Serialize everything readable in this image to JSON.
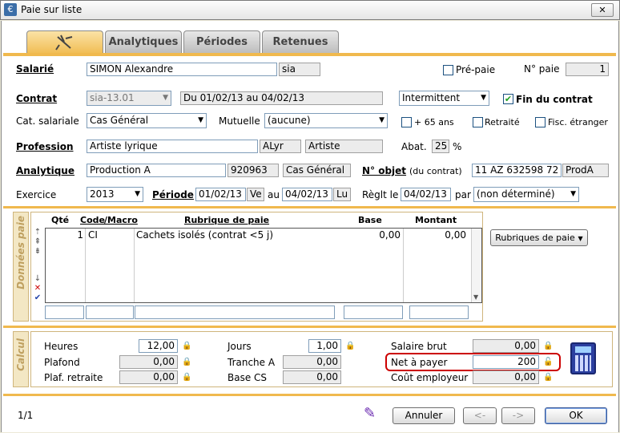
{
  "window": {
    "title": "Paie sur liste",
    "close": "✕"
  },
  "tabs": [
    {
      "label": ""
    },
    {
      "label": "Analytiques"
    },
    {
      "label": "Périodes"
    },
    {
      "label": "Retenues"
    }
  ],
  "header": {
    "salarie_label": "Salarié",
    "salarie_name": "SIMON Alexandre",
    "salarie_code": "sia",
    "prepaie_label": "Pré-paie",
    "no_paie_label": "N° paie",
    "no_paie": "1",
    "contrat_label": "Contrat",
    "contrat_code": "sia-13.01",
    "contrat_dates": "Du 01/02/13 au 04/02/13",
    "contrat_type": "Intermittent",
    "fin_contrat_label": "Fin du contrat",
    "cat_label": "Cat. salariale",
    "cat_value": "Cas Général",
    "mutuelle_label": "Mutuelle",
    "mutuelle_value": "(aucune)",
    "plus65_label": "+ 65 ans",
    "retraite_label": "Retraité",
    "fisc_label": "Fisc. étranger",
    "profession_label": "Profession",
    "profession_value": "Artiste lyrique",
    "profession_code": "ALyr",
    "profession_cat": "Artiste",
    "abat_label": "Abat.",
    "abat_value": "25",
    "abat_unit": "%",
    "analytique_label": "Analytique",
    "analytique_value": "Production A",
    "analytique_code": "920963",
    "analytique_cat": "Cas Général",
    "no_objet_label": "N° objet",
    "no_objet_sub": "(du contrat)",
    "no_objet_value": "11 AZ 632598 72",
    "no_objet_code": "ProdA",
    "exercice_label": "Exercice",
    "exercice_value": "2013",
    "periode_label": "Période",
    "periode_start": "01/02/13",
    "periode_start_day": "Ve",
    "au_label": "au",
    "periode_end": "04/02/13",
    "periode_end_day": "Lu",
    "reglt_label": "Règlt le",
    "reglt_date": "04/02/13",
    "par_label": "par",
    "reglt_mode": "(non déterminé)"
  },
  "donnees": {
    "side_label": "Données paie",
    "columns": {
      "qte": "Qté",
      "code": "Code",
      "macro": "/Macro",
      "rubrique": "Rubrique de paie",
      "base": "Base",
      "montant": "Montant"
    },
    "rows": [
      {
        "qte": "1",
        "code": "CI",
        "rubrique": "Cachets isolés (contrat <5 j)",
        "base": "0,00",
        "montant": "0,00"
      }
    ],
    "rubriques_button": "Rubriques de paie"
  },
  "calcul": {
    "side_label": "Calcul",
    "heures_label": "Heures",
    "heures": "12,00",
    "plafond_label": "Plafond",
    "plafond": "0,00",
    "plaf_retraite_label": "Plaf. retraite",
    "plaf_retraite": "0,00",
    "jours_label": "Jours",
    "jours": "1,00",
    "tranche_a_label": "Tranche A",
    "tranche_a": "0,00",
    "base_cs_label": "Base CS",
    "base_cs": "0,00",
    "salaire_brut_label": "Salaire brut",
    "salaire_brut": "0,00",
    "net_label": "Net à payer",
    "net": "200",
    "cout_label": "Coût employeur",
    "cout": "0,00"
  },
  "footer": {
    "page": "1/1",
    "annuler": "Annuler",
    "prev": "<-",
    "next": "->",
    "ok": "OK"
  },
  "colors": {
    "accent": "#f0b94e",
    "highlight": "#cc0000"
  }
}
